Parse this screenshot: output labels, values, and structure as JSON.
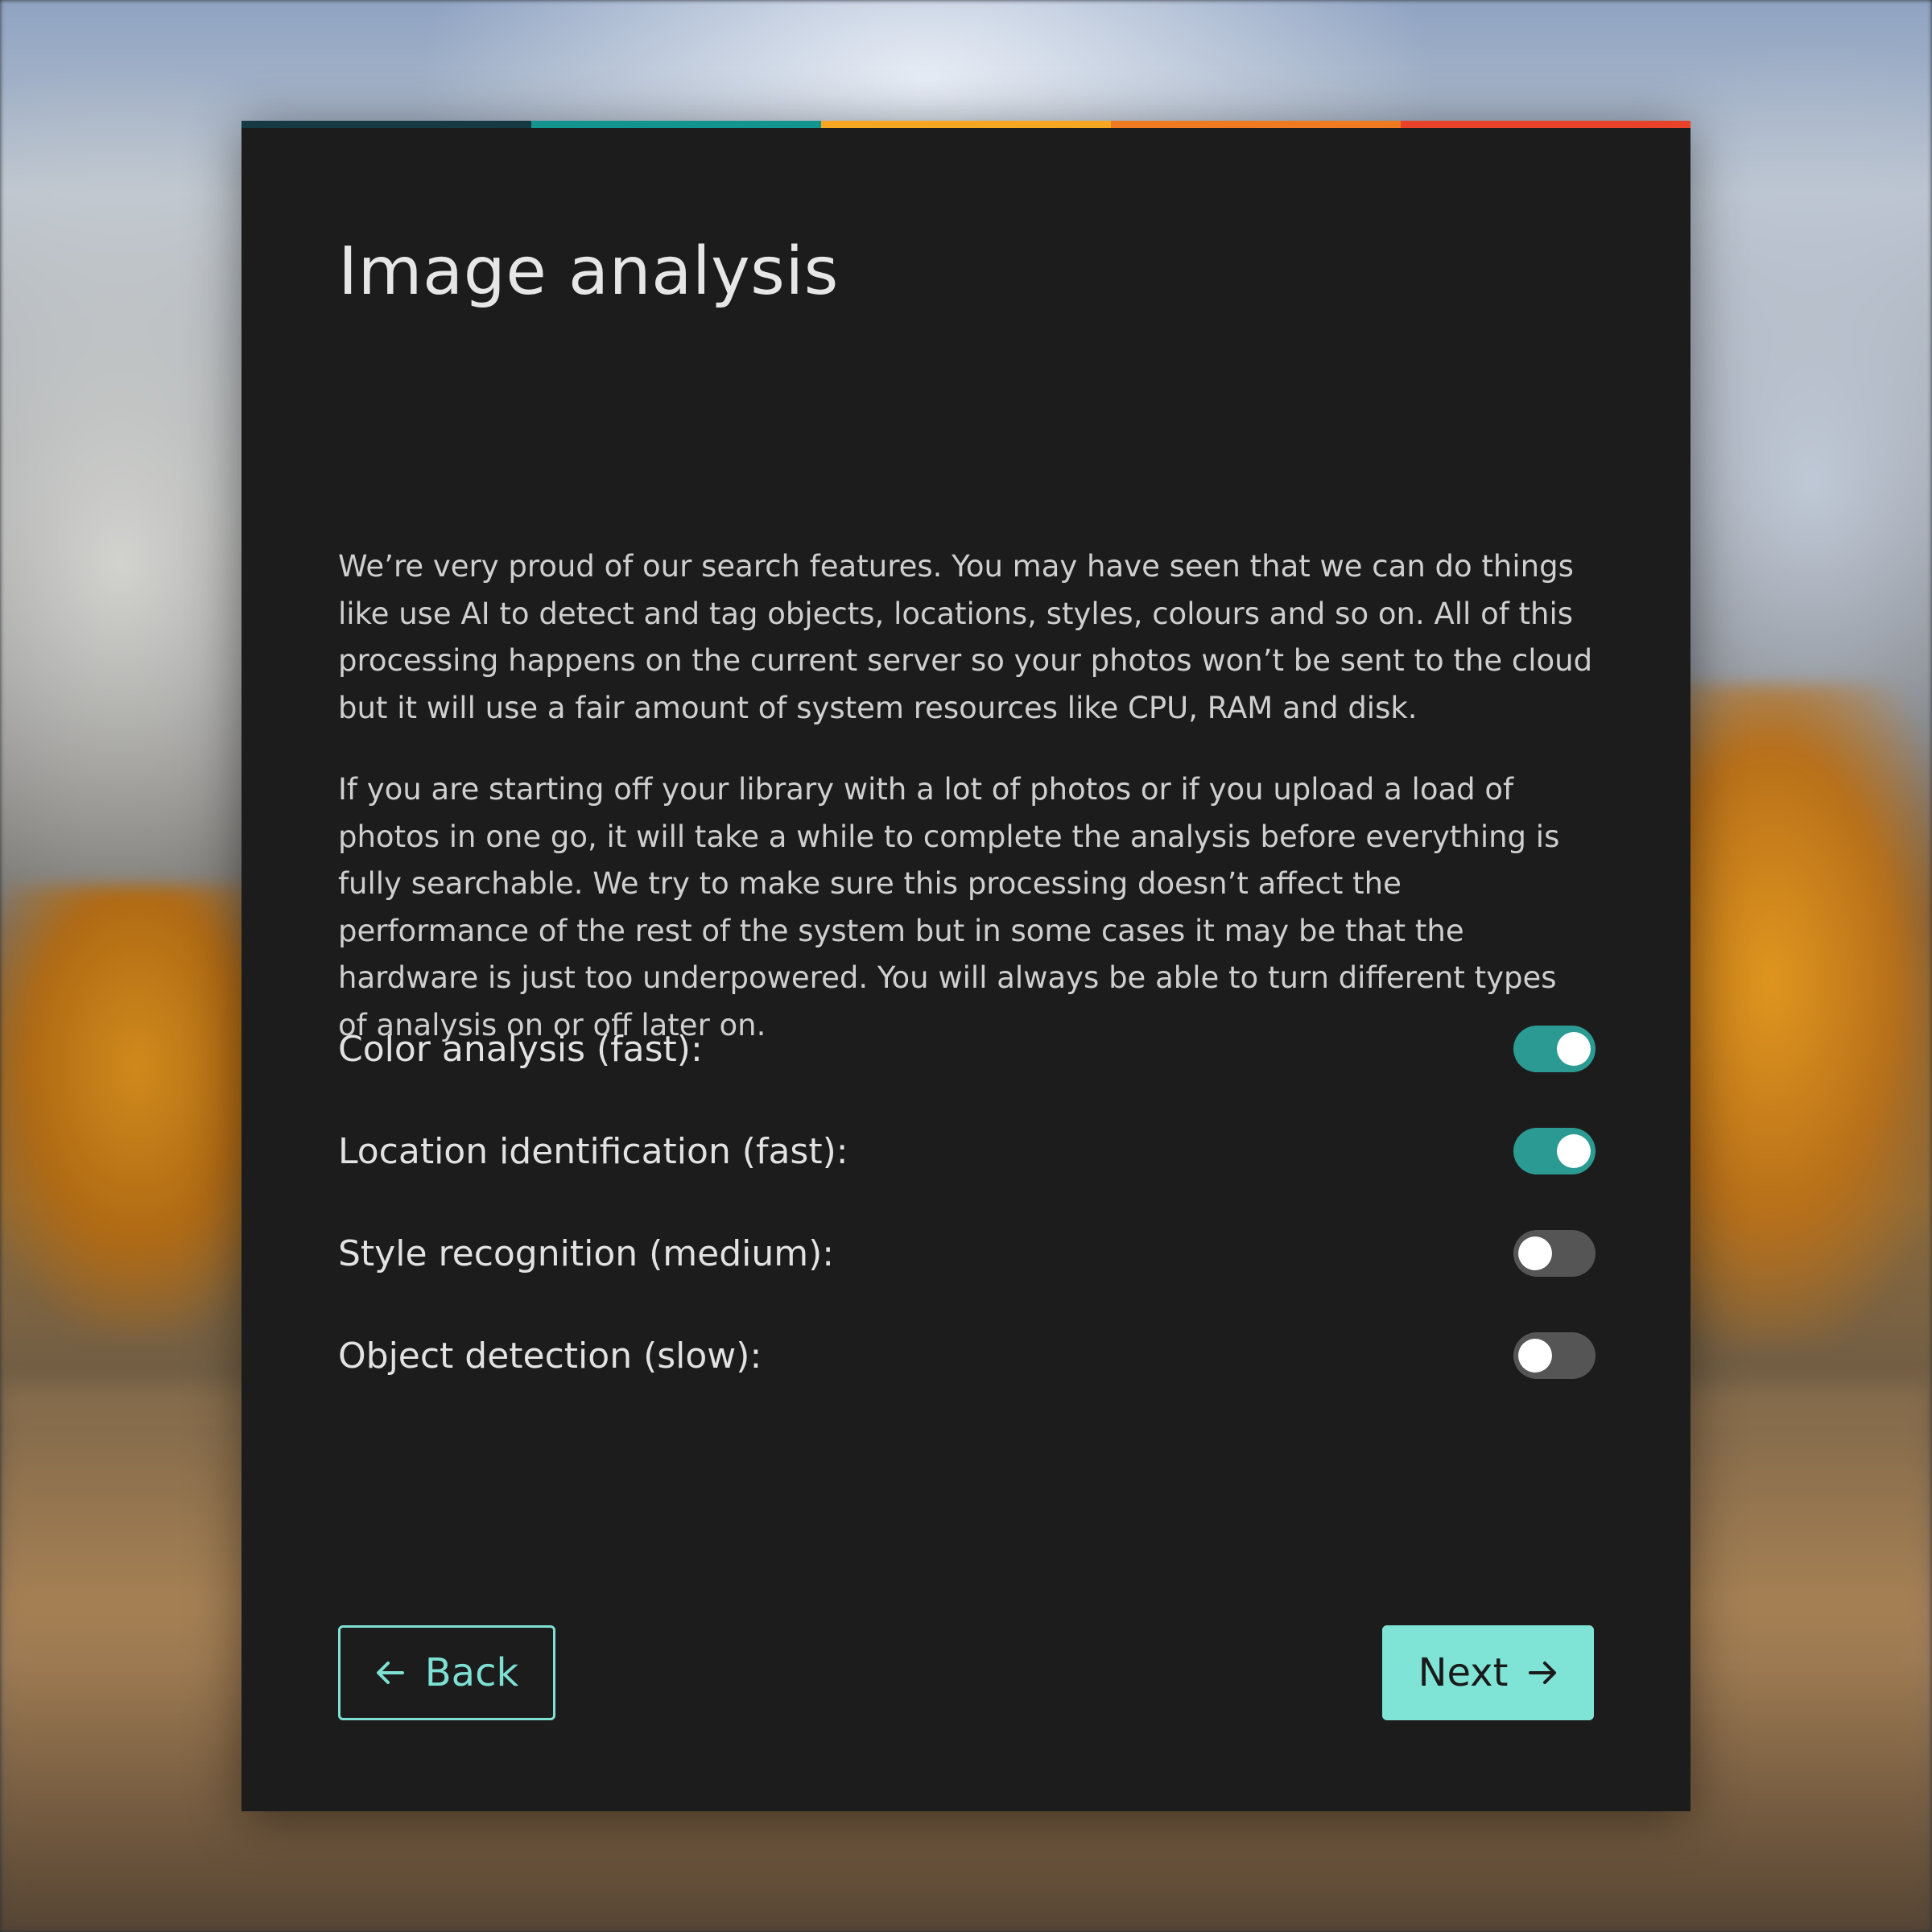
{
  "colors": {
    "card_background": "#1c1c1c",
    "accent": "#7fe3d6",
    "toggle_on": "#2a9a93",
    "toggle_off": "#555555",
    "stripe": [
      "#163a44",
      "#12958e",
      "#f5a623",
      "#f07a22",
      "#e8432a"
    ]
  },
  "page": {
    "title": "Image analysis",
    "paragraphs": [
      "We’re very proud of our search features. You may have seen that we can do things like use AI to detect and tag objects, locations, styles, colours and so on. All of this processing happens on the current server so your photos won’t be sent to the cloud but it will use a fair amount of system resources like CPU, RAM and disk.",
      "If you are starting off your library with a lot of photos or if you upload a load of photos in one go, it will take a while to complete the analysis before everything is fully searchable. We try to make sure this processing doesn’t affect the performance of the rest of the system but in some cases it may be that the hardware is just too underpowered. You will always be able to turn different types of analysis on or off later on."
    ]
  },
  "options": [
    {
      "label": "Color analysis (fast):",
      "enabled": true
    },
    {
      "label": "Location identification (fast):",
      "enabled": true
    },
    {
      "label": "Style recognition (medium):",
      "enabled": false
    },
    {
      "label": "Object detection (slow):",
      "enabled": false
    }
  ],
  "buttons": {
    "back_label": "Back",
    "back_icon": "arrow-left-icon",
    "next_label": "Next",
    "next_icon": "arrow-right-icon"
  }
}
